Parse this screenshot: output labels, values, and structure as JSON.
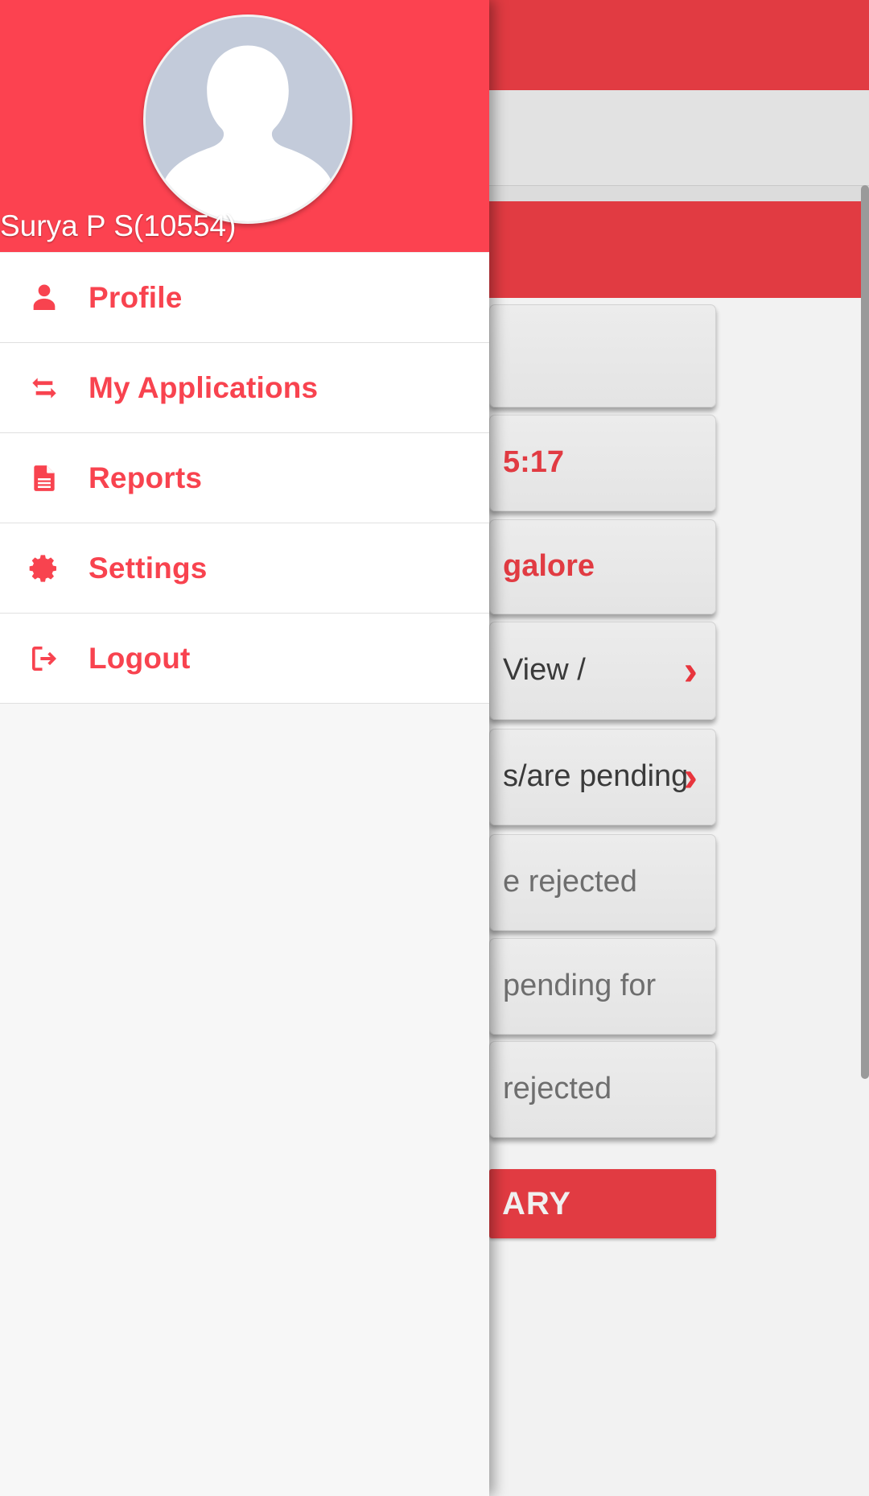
{
  "app": {
    "accent_red": "#FC4250",
    "content_red": "#E13B42",
    "menu_text_red": "#F8434F"
  },
  "background": {
    "toolbar": {
      "icon": "list-icon"
    },
    "cards": [
      {
        "text": "",
        "style": "red",
        "chevron": false
      },
      {
        "text": "5:17",
        "style": "red",
        "chevron": false
      },
      {
        "text": "galore",
        "style": "red",
        "chevron": false
      },
      {
        "text": "View /",
        "style": "dark",
        "chevron": true
      },
      {
        "text": "s/are pending",
        "style": "dark",
        "chevron": true
      },
      {
        "text": "e rejected",
        "style": "gray",
        "chevron": false
      },
      {
        "text": "pending for",
        "style": "gray",
        "chevron": false
      },
      {
        "text": "rejected",
        "style": "gray",
        "chevron": false
      }
    ],
    "summary_button": {
      "label": "ARY"
    }
  },
  "drawer": {
    "header": {
      "avatar": "user-avatar-placeholder",
      "username": "Surya P S(10554)"
    },
    "items": [
      {
        "label": "Profile",
        "icon": "user-icon"
      },
      {
        "label": "My Applications",
        "icon": "exchange-arrows-icon"
      },
      {
        "label": "Reports",
        "icon": "document-icon"
      },
      {
        "label": "Settings",
        "icon": "gear-icon"
      },
      {
        "label": "Logout",
        "icon": "sign-out-icon"
      }
    ]
  }
}
